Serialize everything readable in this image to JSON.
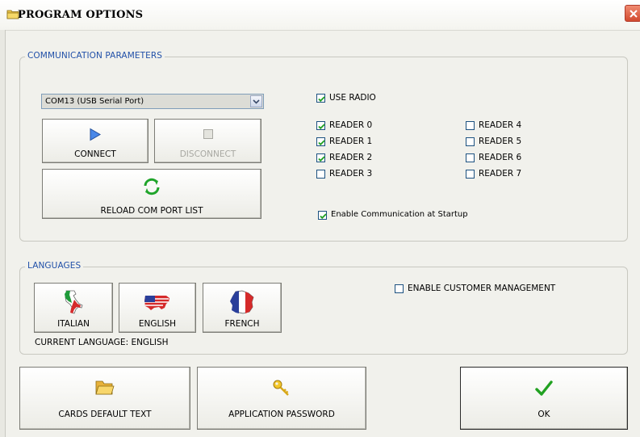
{
  "window": {
    "title": "PROGRAM OPTIONS"
  },
  "communication": {
    "legend": "COMMUNICATION PARAMETERS",
    "port_selected": "COM13 (USB Serial Port)",
    "connect_label": "CONNECT",
    "disconnect_label": "DISCONNECT",
    "reload_label": "RELOAD COM PORT LIST",
    "use_radio": {
      "label": "USE RADIO",
      "checked": true
    },
    "readers": [
      {
        "label": "READER 0",
        "checked": true
      },
      {
        "label": "READER 1",
        "checked": true
      },
      {
        "label": "READER 2",
        "checked": true
      },
      {
        "label": "READER 3",
        "checked": false
      },
      {
        "label": "READER 4",
        "checked": false
      },
      {
        "label": "READER 5",
        "checked": false
      },
      {
        "label": "READER 6",
        "checked": false
      },
      {
        "label": "READER 7",
        "checked": false
      }
    ],
    "enable_startup": {
      "label": "Enable Communication at Startup",
      "checked": true
    }
  },
  "languages": {
    "legend": "LANGUAGES",
    "italian_label": "ITALIAN",
    "english_label": "ENGLISH",
    "french_label": "FRENCH",
    "current_language": "CURRENT LANGUAGE: ENGLISH",
    "customer_mgmt": {
      "label": "ENABLE CUSTOMER MANAGEMENT",
      "checked": false
    }
  },
  "footer": {
    "cards_text_label": "CARDS DEFAULT TEXT",
    "app_password_label": "APPLICATION PASSWORD",
    "ok_label": "OK"
  },
  "colors": {
    "legend": "#2150a8",
    "check": "#21a121",
    "connect_icon": "#3a78d8"
  }
}
